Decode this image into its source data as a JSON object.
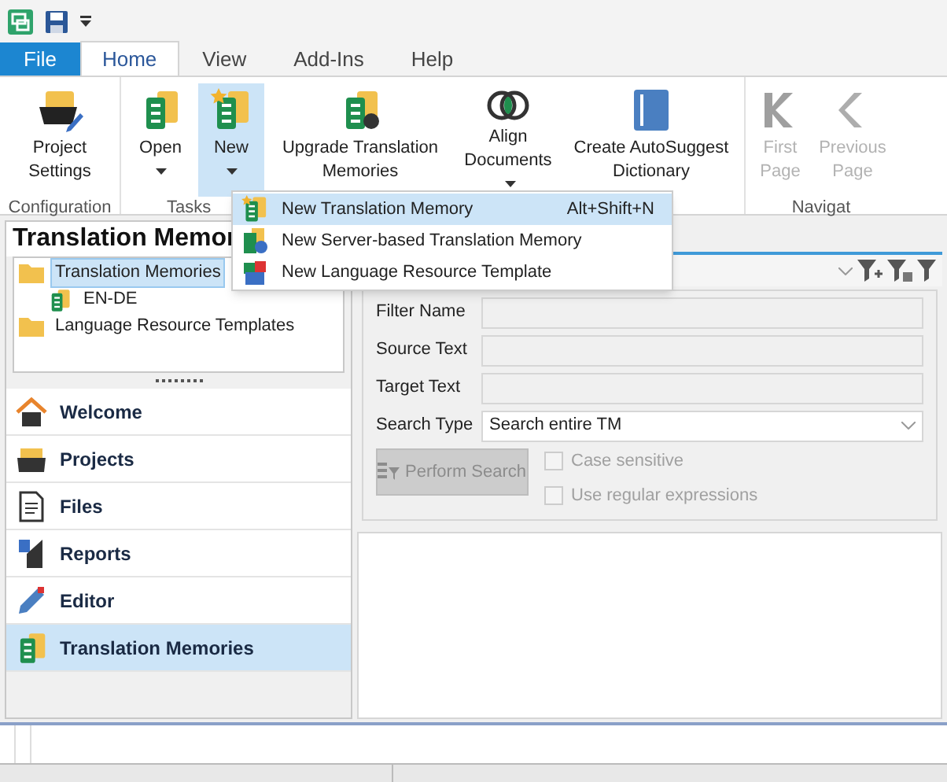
{
  "tabs": [
    {
      "label": "File",
      "kind": "file",
      "selected": false
    },
    {
      "label": "Home",
      "kind": "tab",
      "selected": true
    },
    {
      "label": "View",
      "kind": "tab",
      "selected": false
    },
    {
      "label": "Add-Ins",
      "kind": "tab",
      "selected": false
    },
    {
      "label": "Help",
      "kind": "tab",
      "selected": false
    }
  ],
  "ribbon": {
    "groups": [
      {
        "label": "Configuration",
        "buttons": [
          {
            "label": "Project Settings",
            "dropdown": false,
            "disabled": false,
            "selected": false
          }
        ]
      },
      {
        "label": "Tasks",
        "buttons": [
          {
            "label": "Open",
            "dropdown": true,
            "disabled": false,
            "selected": false
          },
          {
            "label": "New",
            "dropdown": true,
            "disabled": false,
            "selected": true
          },
          {
            "label": "Upgrade Translation Memories",
            "dropdown": false,
            "disabled": false,
            "selected": false
          },
          {
            "label": "Align Documents",
            "dropdown": true,
            "disabled": false,
            "selected": false
          },
          {
            "label": "Create AutoSuggest Dictionary",
            "dropdown": false,
            "disabled": false,
            "selected": false
          }
        ]
      },
      {
        "label": "Navigat",
        "buttons": [
          {
            "label": "First Page",
            "dropdown": false,
            "disabled": true,
            "selected": false
          },
          {
            "label": "Previous Page",
            "dropdown": false,
            "disabled": true,
            "selected": false
          }
        ]
      }
    ]
  },
  "menu": {
    "items": [
      {
        "label": "New Translation Memory",
        "shortcut": "Alt+Shift+N",
        "selected": true
      },
      {
        "label": "New Server-based Translation Memory",
        "selected": false
      },
      {
        "label": "New Language Resource Template",
        "selected": false
      }
    ]
  },
  "left_panel": {
    "title": "Translation Memor",
    "tree": [
      {
        "label": "Translation Memories",
        "selected": true,
        "children": [
          {
            "label": "EN-DE",
            "selected": false
          }
        ]
      },
      {
        "label": "Language Resource Templates",
        "selected": false
      }
    ],
    "nav": [
      {
        "label": "Welcome",
        "selected": false
      },
      {
        "label": "Projects",
        "selected": false
      },
      {
        "label": "Files",
        "selected": false
      },
      {
        "label": "Reports",
        "selected": false
      },
      {
        "label": "Editor",
        "selected": false
      },
      {
        "label": "Translation Memories",
        "selected": true
      }
    ]
  },
  "filter": {
    "fields": [
      {
        "label": "Filter Name",
        "kind": "text"
      },
      {
        "label": "Source Text",
        "kind": "text"
      },
      {
        "label": "Target Text",
        "kind": "text"
      },
      {
        "label": "Search Type",
        "kind": "select",
        "value": "Search entire TM"
      }
    ],
    "search_button": {
      "label": "Perform Search",
      "disabled": true
    },
    "options": [
      {
        "label": "Case sensitive",
        "checked": false,
        "disabled": true
      },
      {
        "label": "Use regular expressions",
        "checked": false,
        "disabled": true
      }
    ]
  }
}
